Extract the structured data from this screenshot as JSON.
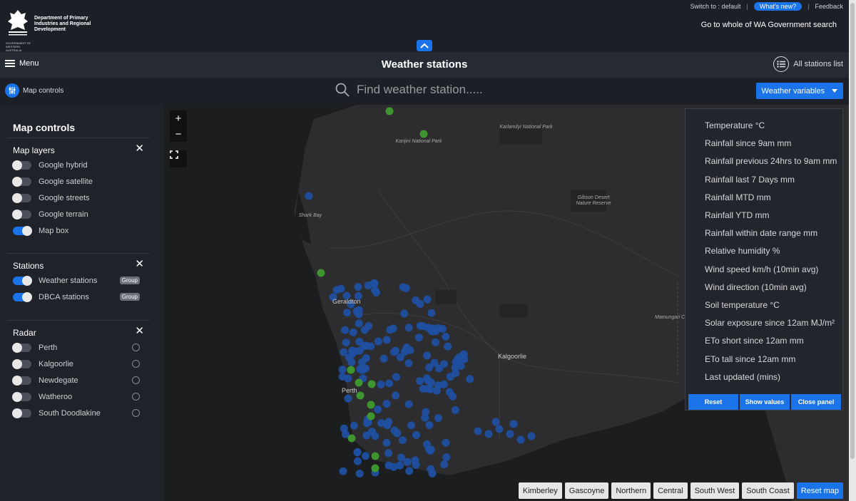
{
  "header": {
    "logo_text": "Department of Primary Industries and Regional Development",
    "logo_subtext": "GOVERNMENT OF WESTERN AUSTRALIA",
    "switch_to": "Switch to : default",
    "whats_new": "What's new?",
    "feedback": "Feedback",
    "wa_search": "Go to whole of WA Government search"
  },
  "titlebar": {
    "menu": "Menu",
    "title": "Weather stations",
    "all_stations": "All stations list"
  },
  "searchbar": {
    "map_controls": "Map controls",
    "placeholder": "Find weather station.....",
    "weather_variables": "Weather variables"
  },
  "sidebar": {
    "title": "Map controls",
    "map_layers": {
      "heading": "Map layers",
      "items": [
        {
          "label": "Google hybrid",
          "on": false
        },
        {
          "label": "Google satellite",
          "on": false
        },
        {
          "label": "Google streets",
          "on": false
        },
        {
          "label": "Google terrain",
          "on": false
        },
        {
          "label": "Map box",
          "on": true
        }
      ]
    },
    "stations": {
      "heading": "Stations",
      "items": [
        {
          "label": "Weather stations",
          "on": true,
          "tag": "Group"
        },
        {
          "label": "DBCA stations",
          "on": true,
          "tag": "Group"
        }
      ]
    },
    "radar": {
      "heading": "Radar",
      "items": [
        {
          "label": "Perth",
          "on": false
        },
        {
          "label": "Kalgoorlie",
          "on": false
        },
        {
          "label": "Newdegate",
          "on": false
        },
        {
          "label": "Watheroo",
          "on": false
        },
        {
          "label": "South Doodlakine",
          "on": false
        }
      ]
    }
  },
  "map": {
    "zoom_in": "+",
    "zoom_out": "−",
    "labels": {
      "karijini": "Karijini National Park",
      "karlamilyi": "Karlamilyi National Park",
      "gibson": "Gibson Desert Nature Reserve",
      "shark_bay": "Shark Bay",
      "mamungari": "Mamungari Cons",
      "geraldton": "Geraldton",
      "kalgoorlie": "Kalgoorlie",
      "perth": "Perth"
    }
  },
  "variables_panel": {
    "items": [
      "Temperature °C",
      "Rainfall since 9am mm",
      "Rainfall previous 24hrs to 9am mm",
      "Rainfall last 7 Days mm",
      "Rainfall MTD mm",
      "Rainfall YTD mm",
      "Rainfall within date range mm",
      "Relative humidity %",
      "Wind speed km/h (10min avg)",
      "Wind direction (10min avg)",
      "Soil temperature °C",
      "Solar exposure since 12am MJ/m²",
      "ETo short since 12am mm",
      "ETo tall since 12am mm",
      "Last updated (mins)"
    ],
    "reset": "Reset",
    "show_values": "Show values",
    "close_panel": "Close panel"
  },
  "regions": [
    "Kimberley",
    "Gascoyne",
    "Northern",
    "Central",
    "South West",
    "South Coast"
  ],
  "reset_map": "Reset map",
  "colors": {
    "accent": "#1a73e8",
    "station_blue": "#1f4fa0",
    "station_green": "#3f9a2e"
  }
}
